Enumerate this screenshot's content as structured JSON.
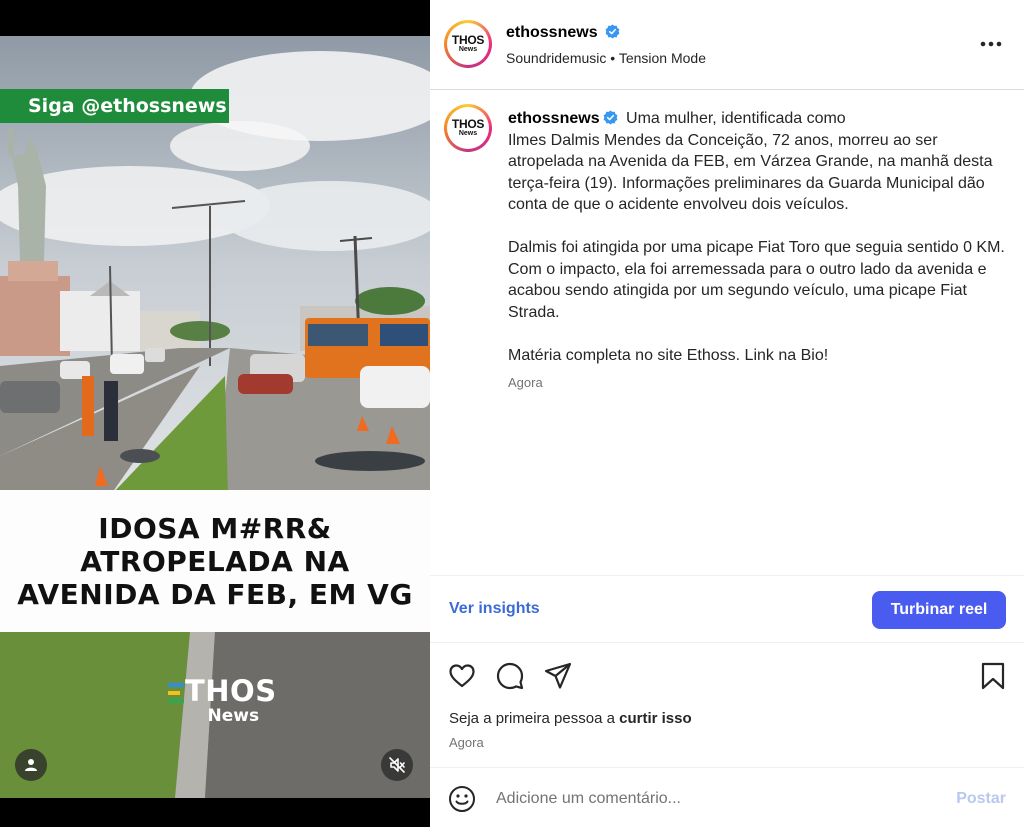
{
  "video": {
    "follow_tag": "Siga @ethossnews",
    "headline": [
      "IDOSA M#RR&",
      "ATROPELADA NA",
      "AVENIDA DA FEB, EM VG"
    ],
    "logo_main": "THOS",
    "logo_sub": "News"
  },
  "header": {
    "avatar_text": "THOS",
    "avatar_sub": "News",
    "username": "ethossnews",
    "audio_artist": "Soundridemusic",
    "audio_separator": "•",
    "audio_track": "Tension Mode"
  },
  "caption": {
    "username": "ethossnews",
    "first_line": "Uma mulher, identificada como",
    "paragraph1_rest": "Ilmes Dalmis Mendes da Conceição, 72 anos, morreu ao ser atropelada na Avenida da FEB, em Várzea Grande, na manhã desta terça-feira (19). Informações preliminares da Guarda Municipal dão conta de que o acidente envolveu dois veículos.",
    "paragraph2": "Dalmis foi atingida por uma picape Fiat Toro que seguia sentido 0 KM. Com o impacto, ela foi arremessada para o outro lado da avenida e acabou sendo atingida por um segundo veículo, uma picape Fiat Strada.",
    "paragraph3": "Matéria completa no site Ethoss. Link na Bio!",
    "time": "Agora"
  },
  "insights": {
    "link": "Ver insights",
    "boost_button": "Turbinar reel"
  },
  "actions": {
    "icons": [
      "heart-icon",
      "comment-icon",
      "share-icon",
      "bookmark-icon"
    ]
  },
  "likes": {
    "prefix": "Seja a primeira pessoa a",
    "action": "curtir isso",
    "time": "Agora"
  },
  "comment": {
    "placeholder": "Adicione um comentário...",
    "post_button": "Postar"
  },
  "colors": {
    "accent": "#4a5bef",
    "link": "#3b6bd6",
    "verified": "#3897f0",
    "follow_tag": "#1f8c3b"
  }
}
